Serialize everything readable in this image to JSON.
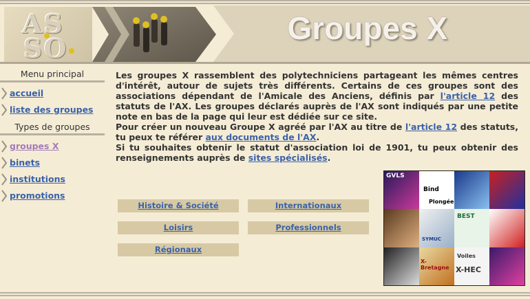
{
  "header": {
    "logo_line1": "AS",
    "logo_line2": "SO",
    "banner_title": "Groupes X"
  },
  "sidebar": {
    "menu_heading": "Menu principal",
    "menu_items": [
      "accueil",
      "liste des groupes"
    ],
    "types_heading": "Types de groupes",
    "type_items": [
      "groupes X",
      "binets",
      "institutions",
      "promotions"
    ],
    "active_item": "groupes X"
  },
  "main": {
    "p1_a": "Les groupes X rassemblent des polytechniciens partageant les mêmes centres d'intérêt, autour de sujets très différents. Certains de ces groupes sont des associations dépendant de l'Amicale des Anciens, définis par ",
    "p1_link": "l'article 12",
    "p1_b": " des statuts de l'AX. Les groupes déclarés auprès de l'AX sont indiqués par une petite note en bas de la page qui leur est dédiée sur ce site.",
    "p2_a": "Pour créer un nouveau Groupe X agréé par l'AX au titre de ",
    "p2_link1": "l'article 12",
    "p2_b": " des statuts, tu peux te référer ",
    "p2_link2": "aux documents de l'AX",
    "p2_c": ".",
    "p3_a": "Si tu souhaites obtenir le statut d'association loi de 1901, tu peux obtenir des renseignements auprès de ",
    "p3_link": "sites spécialisés",
    "p3_b": "."
  },
  "categories": [
    "Histoire & Société",
    "Internationaux",
    "Loisirs",
    "Professionnels",
    "Régionaux"
  ],
  "collage": {
    "labels": [
      "GVLS",
      "Bind",
      "Plongée",
      "BEST",
      "SYMUC",
      "X-Bretagne",
      "Voiles",
      "X-HEC"
    ]
  },
  "colors": {
    "background": "#f5ecd6",
    "link": "#3a62a8",
    "visited_link": "#a47cb8",
    "button_bg": "#d7c9a4"
  }
}
